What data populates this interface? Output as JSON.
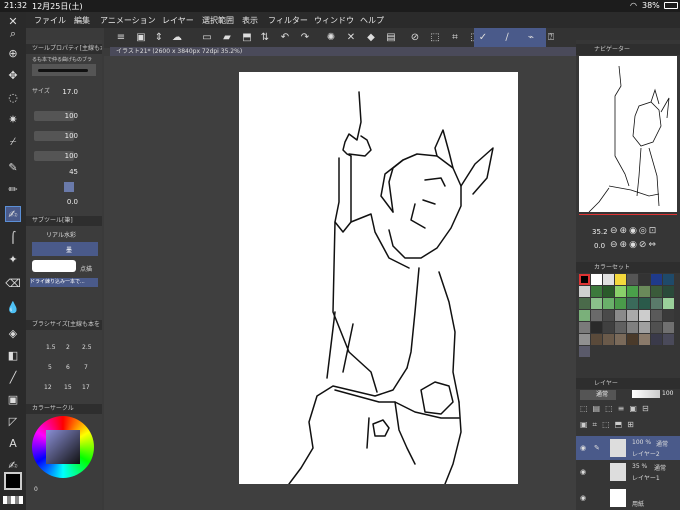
{
  "status": {
    "time": "21:32",
    "date": "12月25日(土)",
    "battery": "38%"
  },
  "menu": [
    "ファイル",
    "編集",
    "アニメーション",
    "レイヤー",
    "選択範囲",
    "表示",
    "フィルター",
    "ウィンドウ",
    "ヘルプ"
  ],
  "document_tab": "イラスト21* (2600 x 3840px 72dpi 35.2%)",
  "tool_property": {
    "header": "ツールプロパティ[主線も本で...",
    "title_line": "るも本で仲る曲げものブラ",
    "size_label": "サイズ",
    "size_value": "17.0",
    "values": [
      "100",
      "100",
      "100"
    ],
    "angle_value": "45",
    "last_value": "0.0"
  },
  "subtool": {
    "header": "サブツール[筆]",
    "items": [
      "リアル水彩",
      "墨",
      "点描"
    ],
    "selected": "ドライ練り込み一本で..."
  },
  "brush_size": {
    "header": "ブラシサイズ[主線も本を",
    "values": [
      "1.5",
      "2",
      "2.5",
      "5",
      "6",
      "7",
      "12",
      "15",
      "17"
    ]
  },
  "color_circle": {
    "header": "カラーサークル",
    "value": "0"
  },
  "navigator": {
    "header": "ナビゲーター",
    "zoom": "35.2",
    "rotate": "0.0"
  },
  "color_set": {
    "header": "カラーセット"
  },
  "layer": {
    "header": "レイヤー",
    "blend": "通常",
    "opacity": "100",
    "layers": [
      {
        "opacity": "100 %",
        "mode": "通常",
        "name": "レイヤー2"
      },
      {
        "opacity": "35 %",
        "mode": "通常",
        "name": "レイヤー1"
      },
      {
        "opacity": "",
        "mode": "",
        "name": "用紙"
      }
    ]
  },
  "colors": {
    "accent": "#5b8fd6",
    "selected": "#4a5a8a"
  }
}
